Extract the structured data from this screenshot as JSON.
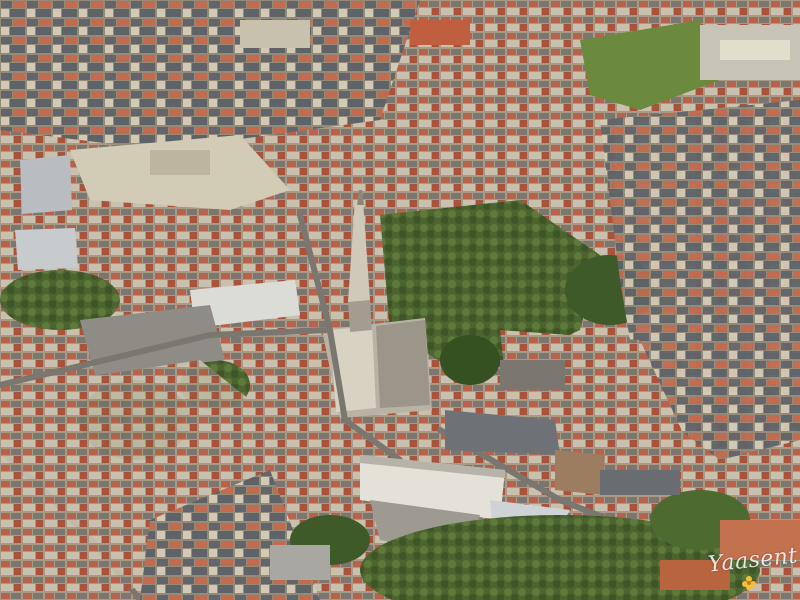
{
  "photo": {
    "subject": "aerial-town-view",
    "signature": "Yaasent",
    "colors": {
      "roof_terracotta": "#b9614a",
      "roof_slate": "#6c6f74",
      "vegetation": "#4f6b34",
      "church_stone": "#b9b3a6",
      "pavement": "#c2bca9"
    }
  }
}
